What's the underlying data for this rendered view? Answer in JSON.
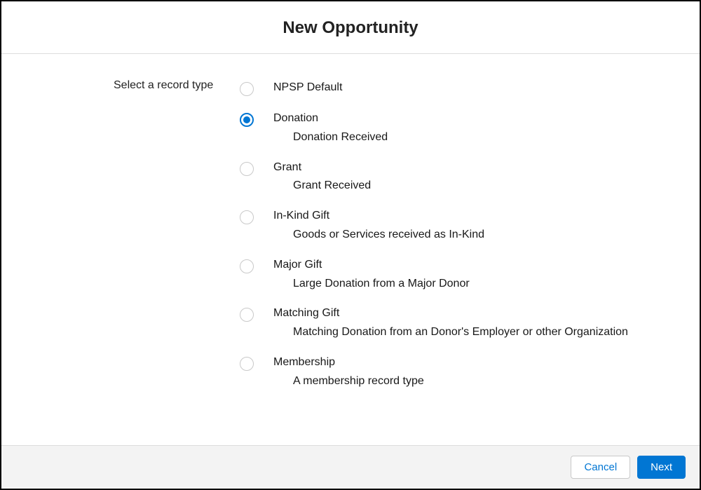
{
  "header": {
    "title": "New Opportunity"
  },
  "form": {
    "label": "Select a record type",
    "selected_index": 1,
    "options": [
      {
        "label": "NPSP Default",
        "description": ""
      },
      {
        "label": "Donation",
        "description": "Donation Received"
      },
      {
        "label": "Grant",
        "description": "Grant Received"
      },
      {
        "label": "In-Kind Gift",
        "description": "Goods or Services received as In-Kind"
      },
      {
        "label": "Major Gift",
        "description": "Large Donation from a Major Donor"
      },
      {
        "label": "Matching Gift",
        "description": "Matching Donation from an Donor's Employer or other Organization"
      },
      {
        "label": "Membership",
        "description": "A membership record type"
      }
    ]
  },
  "footer": {
    "cancel_label": "Cancel",
    "next_label": "Next"
  }
}
